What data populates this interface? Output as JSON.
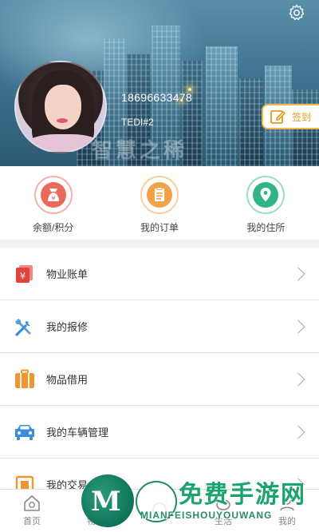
{
  "header": {
    "phone": "18696633478",
    "nickname": "TEDI#2",
    "signin_label": "签到",
    "brand_watermark": "智慧之稀",
    "settings_icon": "gear-icon"
  },
  "quick_actions": [
    {
      "label": "余额/积分",
      "icon": "money-bag-icon",
      "color": "#e96a5c"
    },
    {
      "label": "我的订单",
      "icon": "clipboard-icon",
      "color": "#f0a24a"
    },
    {
      "label": "我的住所",
      "icon": "location-pin-icon",
      "color": "#2fb48a"
    }
  ],
  "menu": [
    {
      "label": "物业账单",
      "icon": "bill-icon",
      "color": "#e0453a"
    },
    {
      "label": "我的报修",
      "icon": "repair-tools-icon",
      "color": "#3a8ed8"
    },
    {
      "label": "物品借用",
      "icon": "luggage-icon",
      "color": "#f0962e"
    },
    {
      "label": "我的车辆管理",
      "icon": "car-icon",
      "color": "#3a8ed8"
    },
    {
      "label": "我的交易",
      "icon": "trade-icon",
      "color": "#f0962e"
    }
  ],
  "tabbar": [
    {
      "label": "首页",
      "icon": "home-icon"
    },
    {
      "label": "物业",
      "icon": "property-icon"
    },
    {
      "label": "",
      "icon": "center-icon"
    },
    {
      "label": "生活",
      "icon": "life-icon"
    },
    {
      "label": "我的",
      "icon": "profile-icon"
    }
  ],
  "watermark": {
    "title": "免费手游网",
    "subtitle": "MIANFEISHOUYOUWANG"
  }
}
